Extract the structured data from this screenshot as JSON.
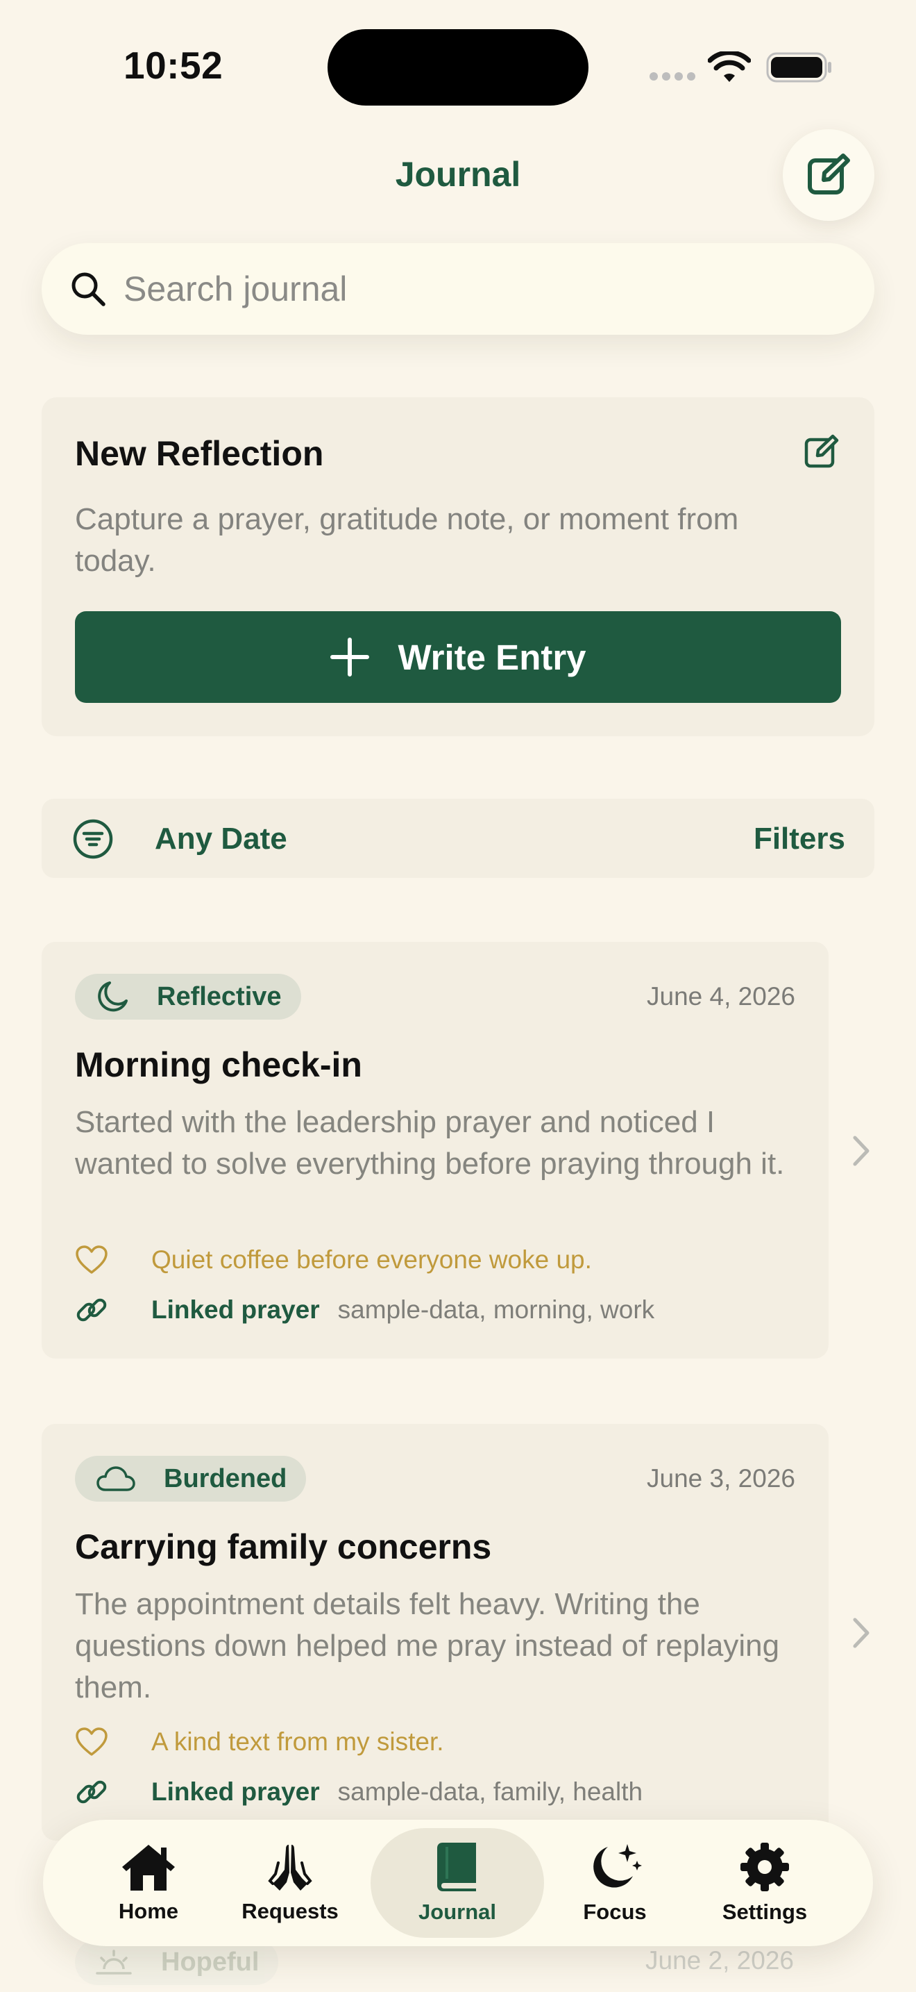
{
  "status_bar": {
    "time": "10:52"
  },
  "header": {
    "title": "Journal"
  },
  "search": {
    "placeholder": "Search journal"
  },
  "new_reflection": {
    "title": "New Reflection",
    "description": "Capture a prayer, gratitude note, or moment from today.",
    "button_label": "Write Entry"
  },
  "filter_bar": {
    "date_label": "Any Date",
    "filters_label": "Filters"
  },
  "entries": [
    {
      "mood": "Reflective",
      "mood_icon": "moon-icon",
      "date": "June 4, 2026",
      "title": "Morning check-in",
      "body": "Started with the leadership prayer and noticed I wanted to solve everything before praying through it.",
      "gratitude": "Quiet coffee before everyone woke up.",
      "linked_label": "Linked prayer",
      "tags": "sample-data, morning, work"
    },
    {
      "mood": "Burdened",
      "mood_icon": "cloud-icon",
      "date": "June 3, 2026",
      "title": "Carrying family concerns",
      "body": "The appointment details felt heavy. Writing the questions down helped me pray instead of replaying them.",
      "gratitude": "A kind text from my sister.",
      "linked_label": "Linked prayer",
      "tags": "sample-data, family, health"
    },
    {
      "mood": "Hopeful",
      "mood_icon": "sunrise-icon",
      "date": "June 2, 2026"
    }
  ],
  "tab_bar": {
    "active": "Journal",
    "tabs": [
      {
        "label": "Home",
        "icon": "house-icon"
      },
      {
        "label": "Requests",
        "icon": "praying-hands-icon"
      },
      {
        "label": "Journal",
        "icon": "book-icon"
      },
      {
        "label": "Focus",
        "icon": "moon-stars-icon"
      },
      {
        "label": "Settings",
        "icon": "gear-icon"
      }
    ]
  },
  "colors": {
    "accent": "#1F5A40",
    "background": "#FAF5EA",
    "card": "#F3EEE2",
    "gratitude": "#C09A3C"
  }
}
